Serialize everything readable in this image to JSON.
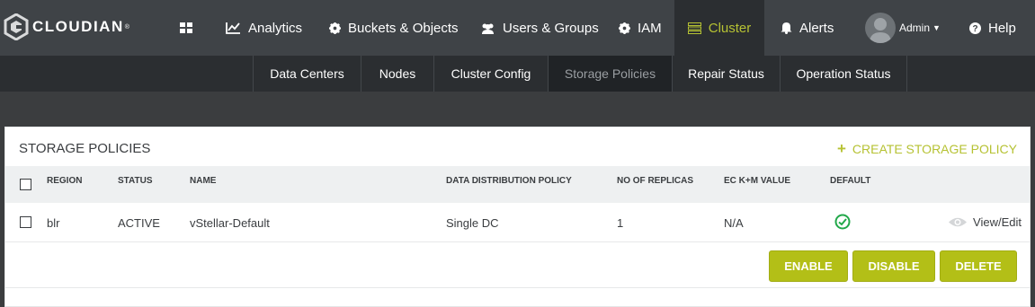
{
  "brand": {
    "name": "CLOUDIAN",
    "tm": "®"
  },
  "nav": {
    "analytics": "Analytics",
    "buckets": "Buckets & Objects",
    "users": "Users & Groups",
    "iam": "IAM",
    "cluster": "Cluster",
    "alerts": "Alerts",
    "admin": "Admin",
    "help": "Help"
  },
  "subnav": {
    "data_centers": "Data Centers",
    "nodes": "Nodes",
    "cluster_config": "Cluster Config",
    "storage_policies": "Storage Policies",
    "repair_status": "Repair Status",
    "operation_status": "Operation Status"
  },
  "panel": {
    "title": "STORAGE POLICIES",
    "create_label": "CREATE STORAGE POLICY"
  },
  "table": {
    "headers": {
      "region": "REGION",
      "status": "STATUS",
      "name": "NAME",
      "ddp": "DATA DISTRIBUTION POLICY",
      "replicas": "NO OF REPLICAS",
      "ec": "EC K+M VALUE",
      "default": "DEFAULT"
    },
    "rows": [
      {
        "region": "blr",
        "status": "ACTIVE",
        "name": "vStellar-Default",
        "ddp": "Single DC",
        "replicas": "1",
        "ec": "N/A",
        "view_edit": "View/Edit"
      }
    ]
  },
  "actions": {
    "enable": "ENABLE",
    "disable": "DISABLE",
    "delete": "DELETE"
  },
  "colors": {
    "accent": "#b6c233",
    "button": "#b3bf17",
    "nav_bg": "#3f4347",
    "success": "#22a84a"
  }
}
